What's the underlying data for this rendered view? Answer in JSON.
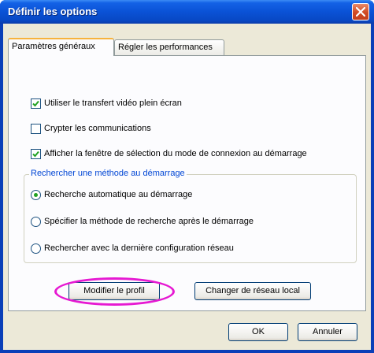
{
  "window": {
    "title": "Définir les options",
    "close_icon": "close-icon"
  },
  "tabs": [
    {
      "label": "Paramètres généraux",
      "active": true
    },
    {
      "label": "Régler les performances",
      "active": false
    }
  ],
  "options": {
    "fullscreen_video": {
      "label": "Utiliser le transfert vidéo plein écran",
      "checked": true
    },
    "encrypt": {
      "label": "Crypter les communications",
      "checked": false
    },
    "show_connection_mode": {
      "label": "Afficher la fenêtre de sélection du mode de connexion au démarrage",
      "checked": true
    }
  },
  "search_group": {
    "legend": "Rechercher une méthode au démarrage",
    "radios": [
      {
        "label": "Recherche automatique au démarrage",
        "selected": true
      },
      {
        "label": "Spécifier la méthode de recherche après le démarrage",
        "selected": false
      },
      {
        "label": "Rechercher avec la dernière configuration réseau",
        "selected": false
      }
    ]
  },
  "buttons": {
    "modify_profile": "Modifier le profil",
    "change_network": "Changer de réseau local",
    "ok": "OK",
    "cancel": "Annuler"
  },
  "colors": {
    "annotation_highlight": "#e619d2",
    "title_bar": "#0a52d6",
    "legend_text": "#0046d5"
  }
}
